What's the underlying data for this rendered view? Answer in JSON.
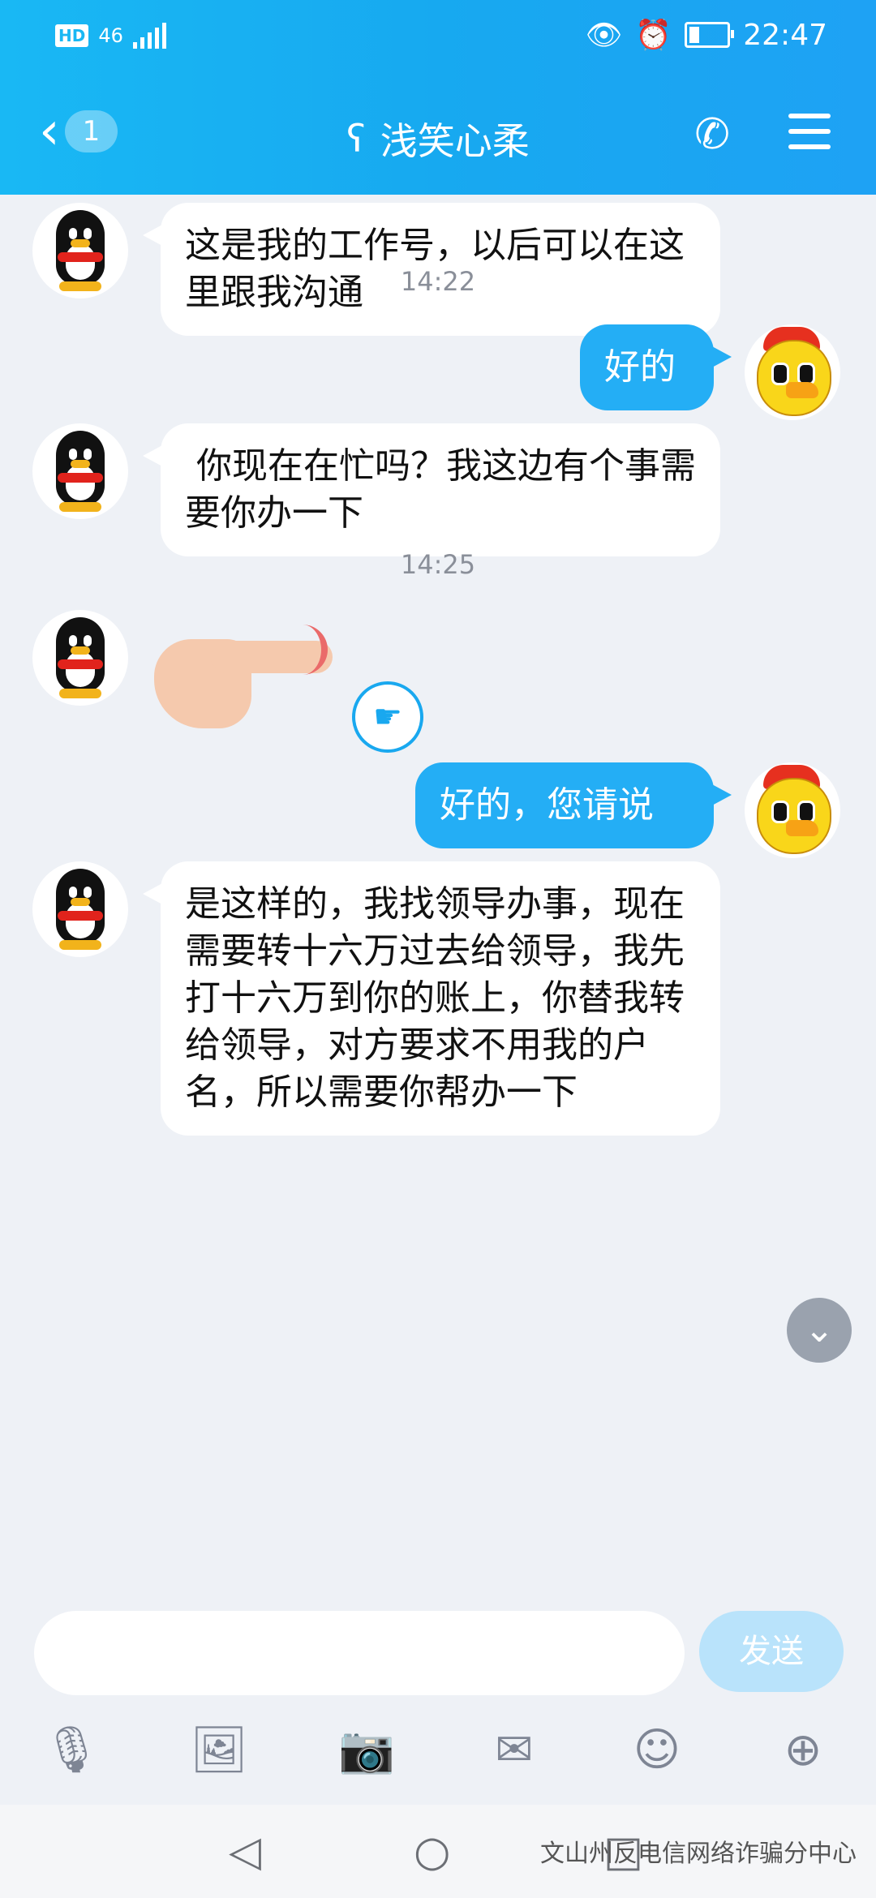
{
  "status_bar": {
    "network": "HD",
    "signal_label": "46",
    "time": "22:47"
  },
  "header": {
    "back_count": "1",
    "title": "浅笑心柔"
  },
  "messages": [
    {
      "side": "in",
      "text": "这是我的工作号，以后可以在这里跟我沟通"
    },
    {
      "type": "time",
      "text": "14:22"
    },
    {
      "side": "out",
      "text": "好的"
    },
    {
      "side": "in",
      "text": " 你现在在忙吗？我这边有个事需要你办一下"
    },
    {
      "type": "time",
      "text": "14:25"
    },
    {
      "side": "in",
      "type": "sticker",
      "text": "pointing-hand sticker"
    },
    {
      "side": "out",
      "text": "好的，您请说"
    },
    {
      "side": "in",
      "text": "是这样的，我找领导办事，现在需要转十六万过去给领导，我先打十六万到你的账上，你替我转给领导，对方要求不用我的户名，所以需要你帮办一下"
    }
  ],
  "input": {
    "placeholder": "",
    "send_label": "发送"
  },
  "tools": [
    "microphone-icon",
    "image-icon",
    "camera-icon",
    "red-packet-icon",
    "emoji-icon",
    "plus-icon"
  ],
  "watermark": "文山州反电信网络诈骗分中心"
}
